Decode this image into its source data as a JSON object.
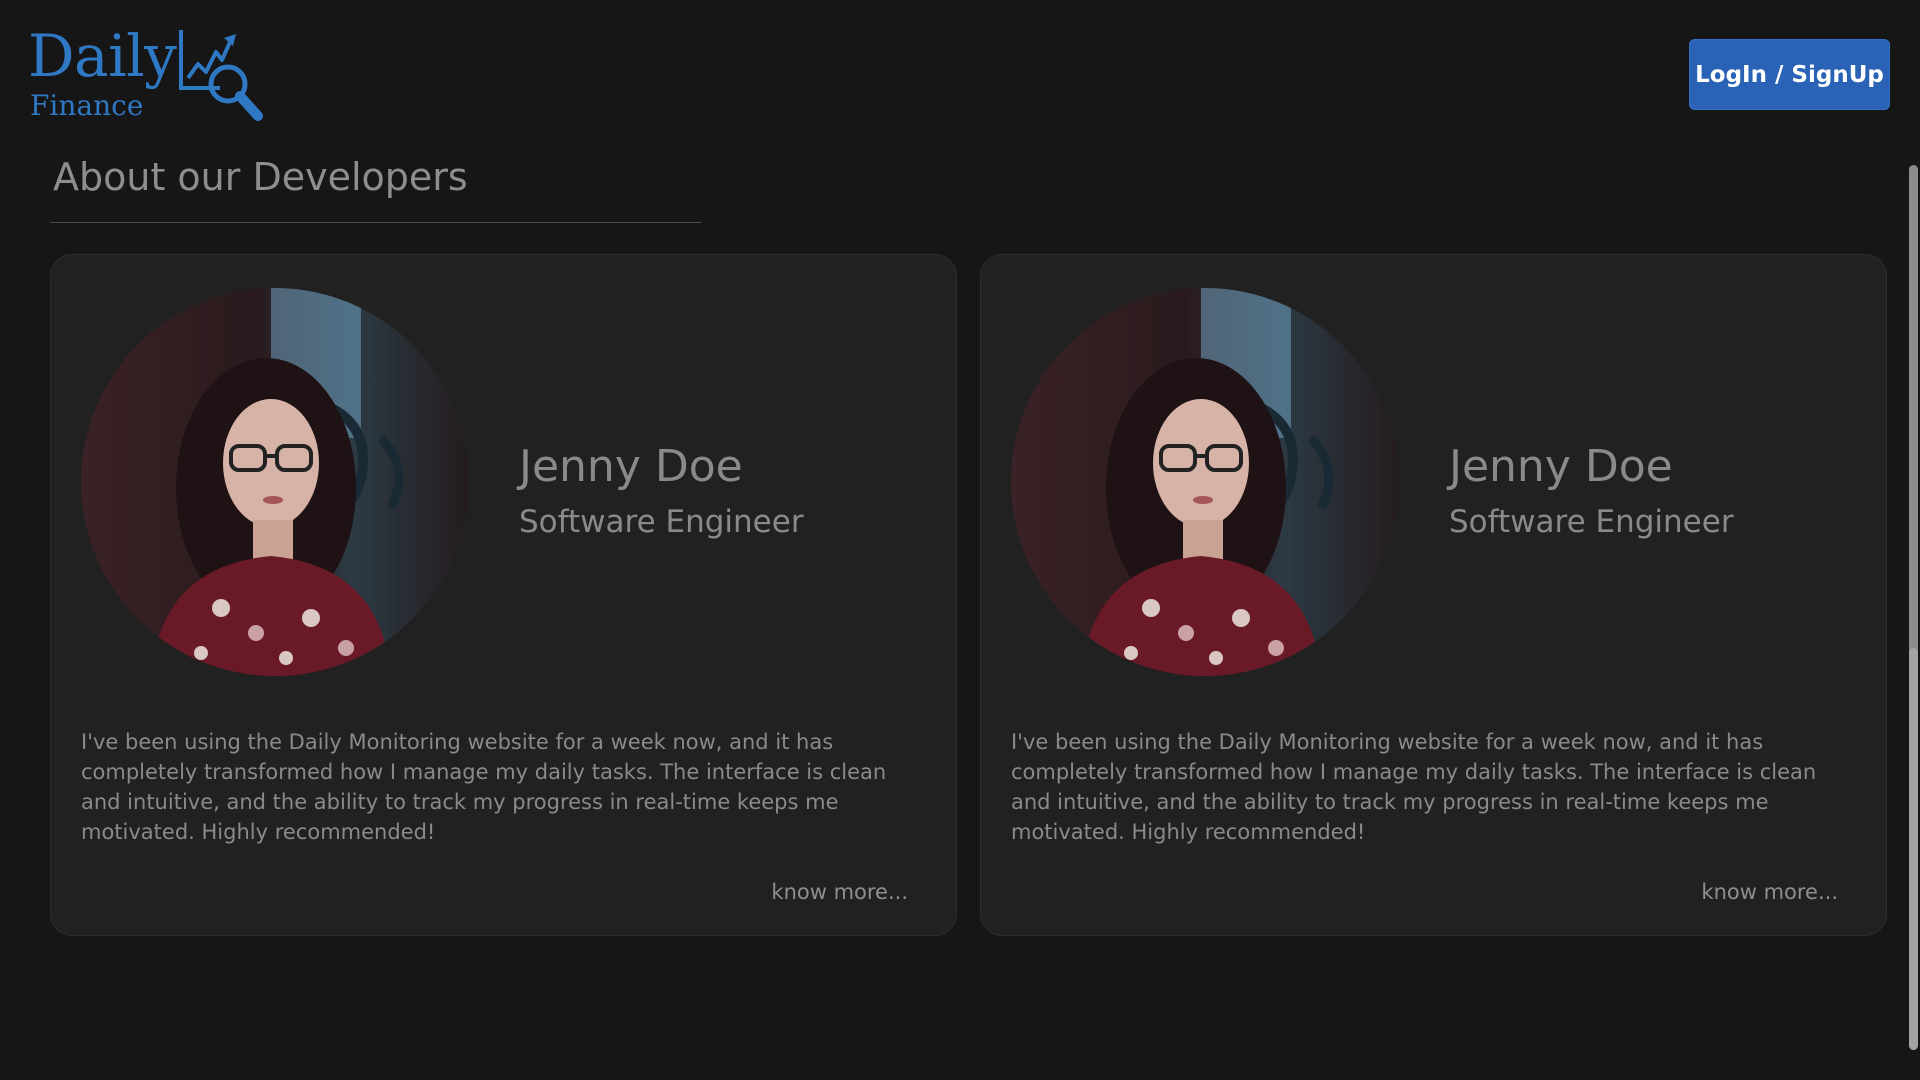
{
  "header": {
    "logo_word": "Daily",
    "logo_sub": "Finance",
    "login_label": "LogIn / SignUp"
  },
  "colors": {
    "brand": "#2f78c4",
    "button": "#2a62b6",
    "background": "#161616",
    "card": "#212121"
  },
  "section": {
    "title": "About our Developers"
  },
  "developers": [
    {
      "name": "Jenny Doe",
      "role": "Software Engineer",
      "bio": "I've been using the Daily Monitoring website for a week now, and it has completely transformed how I manage my daily tasks. The interface is clean and intuitive, and the ability to track my progress in real-time keeps me motivated. Highly recommended!",
      "link_label": "know more..."
    },
    {
      "name": "Jenny Doe",
      "role": "Software Engineer",
      "bio": "I've been using the Daily Monitoring website for a week now, and it has completely transformed how I manage my daily tasks. The interface is clean and intuitive, and the ability to track my progress in real-time keeps me motivated. Highly recommended!",
      "link_label": "know more..."
    }
  ]
}
